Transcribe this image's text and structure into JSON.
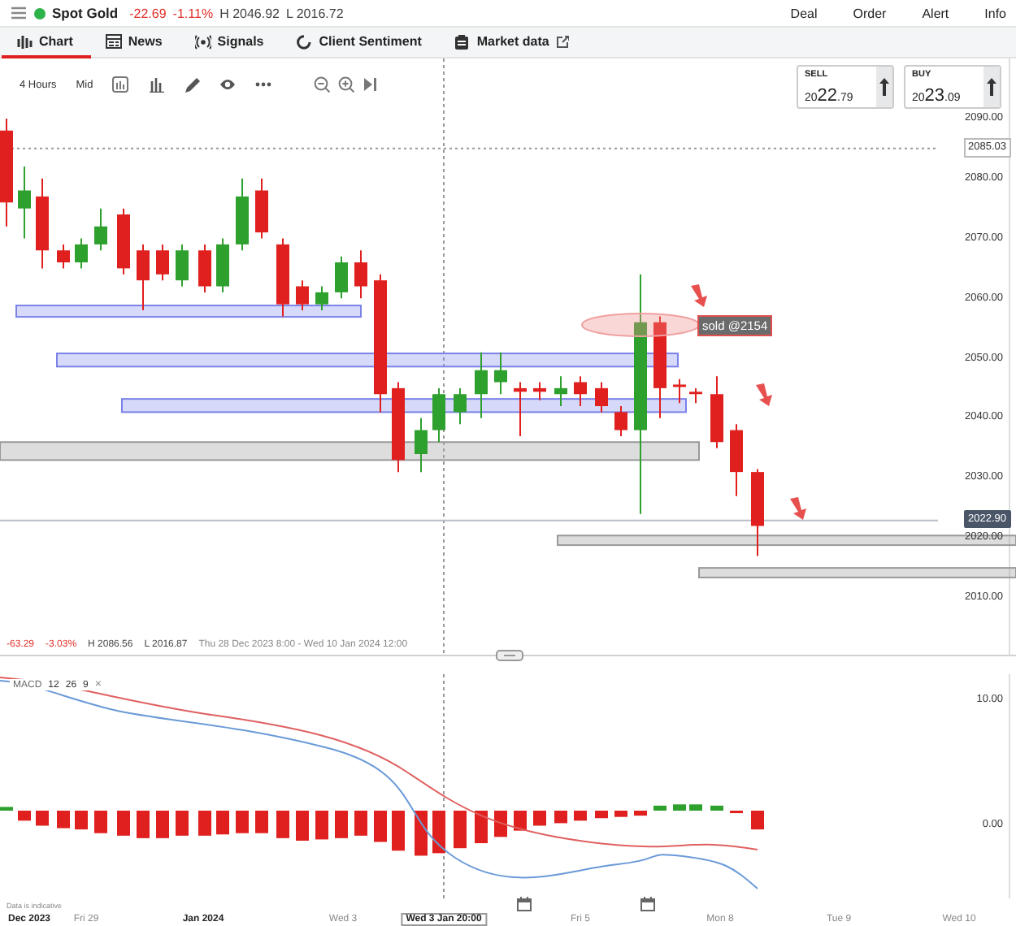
{
  "header": {
    "instrument": "Spot Gold",
    "change": "-22.69",
    "change_pct": "-1.11%",
    "high": "H 2046.92",
    "low": "L 2016.72",
    "menu": [
      "Deal",
      "Order",
      "Alert",
      "Info"
    ]
  },
  "tabs": [
    {
      "label": "Chart",
      "selected": true
    },
    {
      "label": "News",
      "selected": false
    },
    {
      "label": "Signals",
      "selected": false
    },
    {
      "label": "Client Sentiment",
      "selected": false
    },
    {
      "label": "Market data",
      "selected": false
    }
  ],
  "toolbar": {
    "interval": "4 Hours",
    "price_type": "Mid"
  },
  "quotes": [
    {
      "label": "SELL",
      "prefix": "20",
      "big": "22",
      "suffix": ".79"
    },
    {
      "label": "BUY",
      "prefix": "20",
      "big": "23",
      "suffix": ".09"
    }
  ],
  "price_axis": [
    "2090.00",
    "2080.00",
    "2070.00",
    "2060.00",
    "2050.00",
    "2040.00",
    "2030.00",
    "2020.00",
    "2010.00"
  ],
  "marker_price": "2085.03",
  "last_price": "2022.90",
  "annotation": "sold @2154",
  "summary": {
    "change": "-63.29",
    "change_pct": "-3.03%",
    "high": "H 2086.56",
    "low": "L 2016.87",
    "range": "Thu 28 Dec 2023 8:00 - Wed 10 Jan 2024 12:00"
  },
  "macd": {
    "label": "MACD",
    "params": [
      "12",
      "26",
      "9"
    ],
    "close": "×",
    "axis": [
      "10.00",
      "0.00"
    ]
  },
  "disclaimer": "Data is indicative",
  "time_axis": [
    {
      "label": "Dec 2023",
      "bold": true
    },
    {
      "label": "Fri 29",
      "bold": false
    },
    {
      "label": "Jan 2024",
      "bold": true
    },
    {
      "label": "Wed 3",
      "bold": false
    },
    {
      "label": "Fri 5",
      "bold": false
    },
    {
      "label": "Mon 8",
      "bold": false
    },
    {
      "label": "Tue 9",
      "bold": false
    },
    {
      "label": "Wed 10",
      "bold": false
    }
  ],
  "crosshair_label": "Wed 3 Jan 20:00"
}
